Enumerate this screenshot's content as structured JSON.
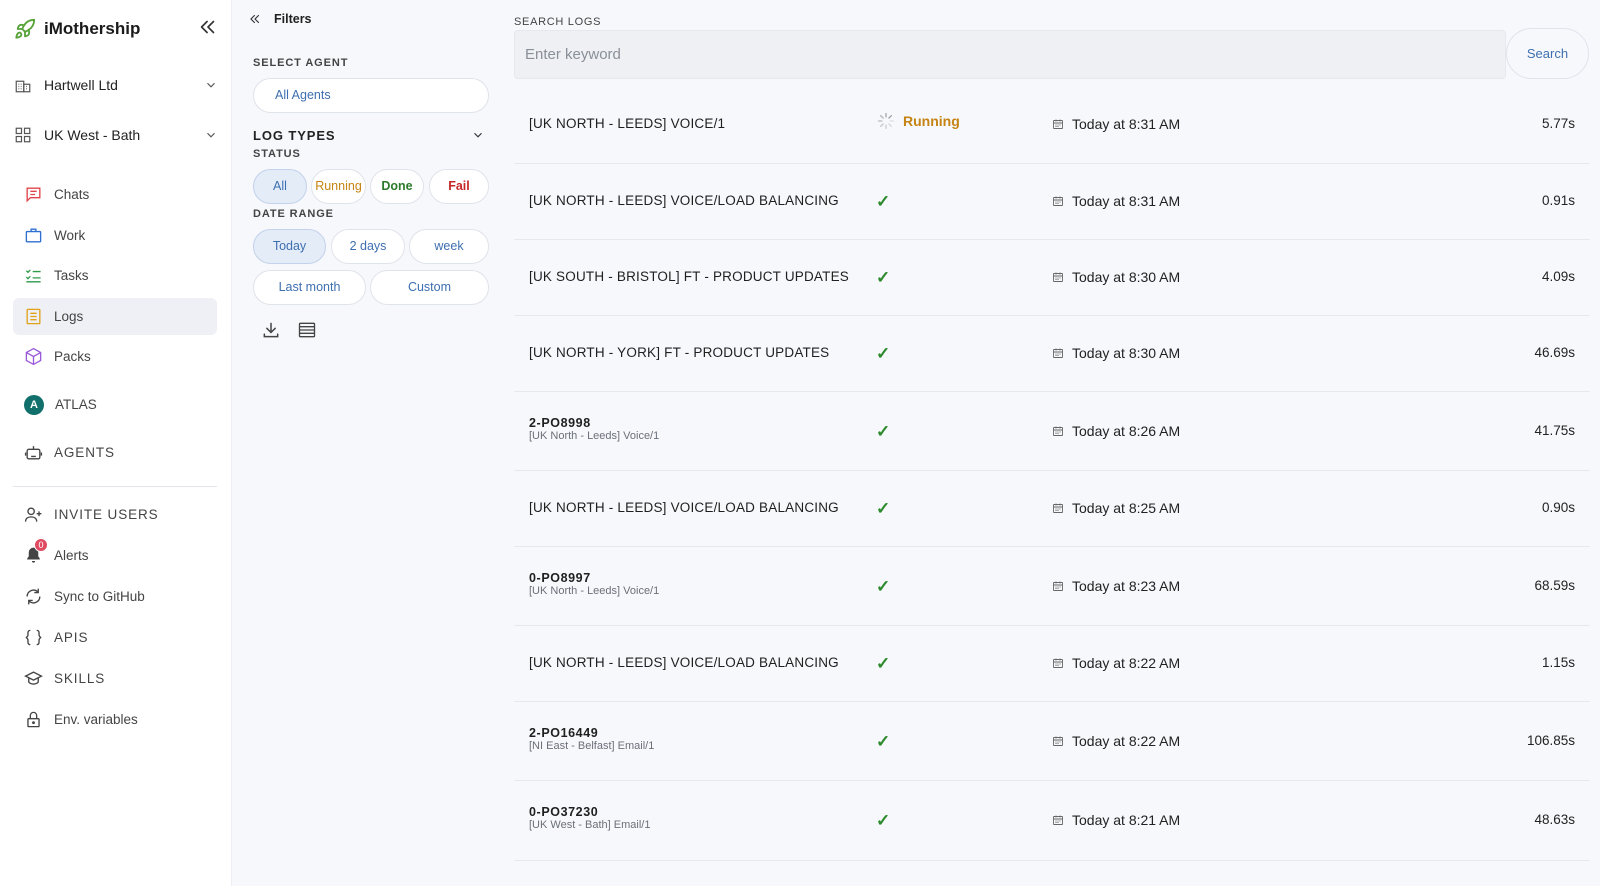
{
  "app": {
    "name": "iMothership"
  },
  "sidebar": {
    "org": "Hartwell Ltd",
    "region": "UK West - Bath",
    "nav": [
      {
        "label": "Chats"
      },
      {
        "label": "Work"
      },
      {
        "label": "Tasks"
      },
      {
        "label": "Logs"
      },
      {
        "label": "Packs"
      },
      {
        "label": "ATLAS",
        "avatar": "A"
      },
      {
        "label": "AGENTS"
      },
      {
        "label": "INVITE USERS"
      },
      {
        "label": "Alerts",
        "badge": "0"
      },
      {
        "label": "Sync to GitHub"
      },
      {
        "label": "APIS"
      },
      {
        "label": "SKILLS"
      },
      {
        "label": "Env. variables"
      }
    ]
  },
  "filters": {
    "title": "Filters",
    "select_agent_label": "SELECT AGENT",
    "agent_value": "All Agents",
    "log_types_label": "LOG TYPES",
    "status_label": "STATUS",
    "status_options": [
      "All",
      "Running",
      "Done",
      "Fail"
    ],
    "date_range_label": "DATE RANGE",
    "date_options": [
      "Today",
      "2 days",
      "week",
      "Last month",
      "Custom"
    ]
  },
  "search": {
    "label": "SEARCH LOGS",
    "placeholder": "Enter keyword",
    "button": "Search"
  },
  "logs": [
    {
      "name": "[UK NORTH - LEEDS] VOICE/1",
      "status": "running",
      "status_label": "Running",
      "time": "Today at 8:31 AM",
      "duration": "5.77s"
    },
    {
      "name": "[UK NORTH - LEEDS] VOICE/LOAD BALANCING",
      "status": "done",
      "status_label": "✓",
      "time": "Today at 8:31 AM",
      "duration": "0.91s"
    },
    {
      "name": "[UK SOUTH - BRISTOL] FT - PRODUCT UPDATES",
      "status": "done",
      "status_label": "✓",
      "time": "Today at 8:30 AM",
      "duration": "4.09s"
    },
    {
      "name": "[UK NORTH - YORK] FT - PRODUCT UPDATES",
      "status": "done",
      "status_label": "✓",
      "time": "Today at 8:30 AM",
      "duration": "46.69s"
    },
    {
      "code": "2-PO8998",
      "sub": "[UK North - Leeds] Voice/1",
      "status": "done",
      "status_label": "✓",
      "time": "Today at 8:26 AM",
      "duration": "41.75s"
    },
    {
      "name": "[UK NORTH - LEEDS] VOICE/LOAD BALANCING",
      "status": "done",
      "status_label": "✓",
      "time": "Today at 8:25 AM",
      "duration": "0.90s"
    },
    {
      "code": "0-PO8997",
      "sub": "[UK North - Leeds] Voice/1",
      "status": "done",
      "status_label": "✓",
      "time": "Today at 8:23 AM",
      "duration": "68.59s"
    },
    {
      "name": "[UK NORTH - LEEDS] VOICE/LOAD BALANCING",
      "status": "done",
      "status_label": "✓",
      "time": "Today at 8:22 AM",
      "duration": "1.15s"
    },
    {
      "code": "2-PO16449",
      "sub": "[NI East - Belfast] Email/1",
      "status": "done",
      "status_label": "✓",
      "time": "Today at 8:22 AM",
      "duration": "106.85s"
    },
    {
      "code": "0-PO37230",
      "sub": "[UK West - Bath] Email/1",
      "status": "done",
      "status_label": "✓",
      "time": "Today at 8:21 AM",
      "duration": "48.63s"
    }
  ],
  "colors": {
    "running": "#c58413",
    "done": "#2c8a2c",
    "fail": "#c62828",
    "accent": "#3e6fb0",
    "brand_icon": "#58a33a"
  }
}
